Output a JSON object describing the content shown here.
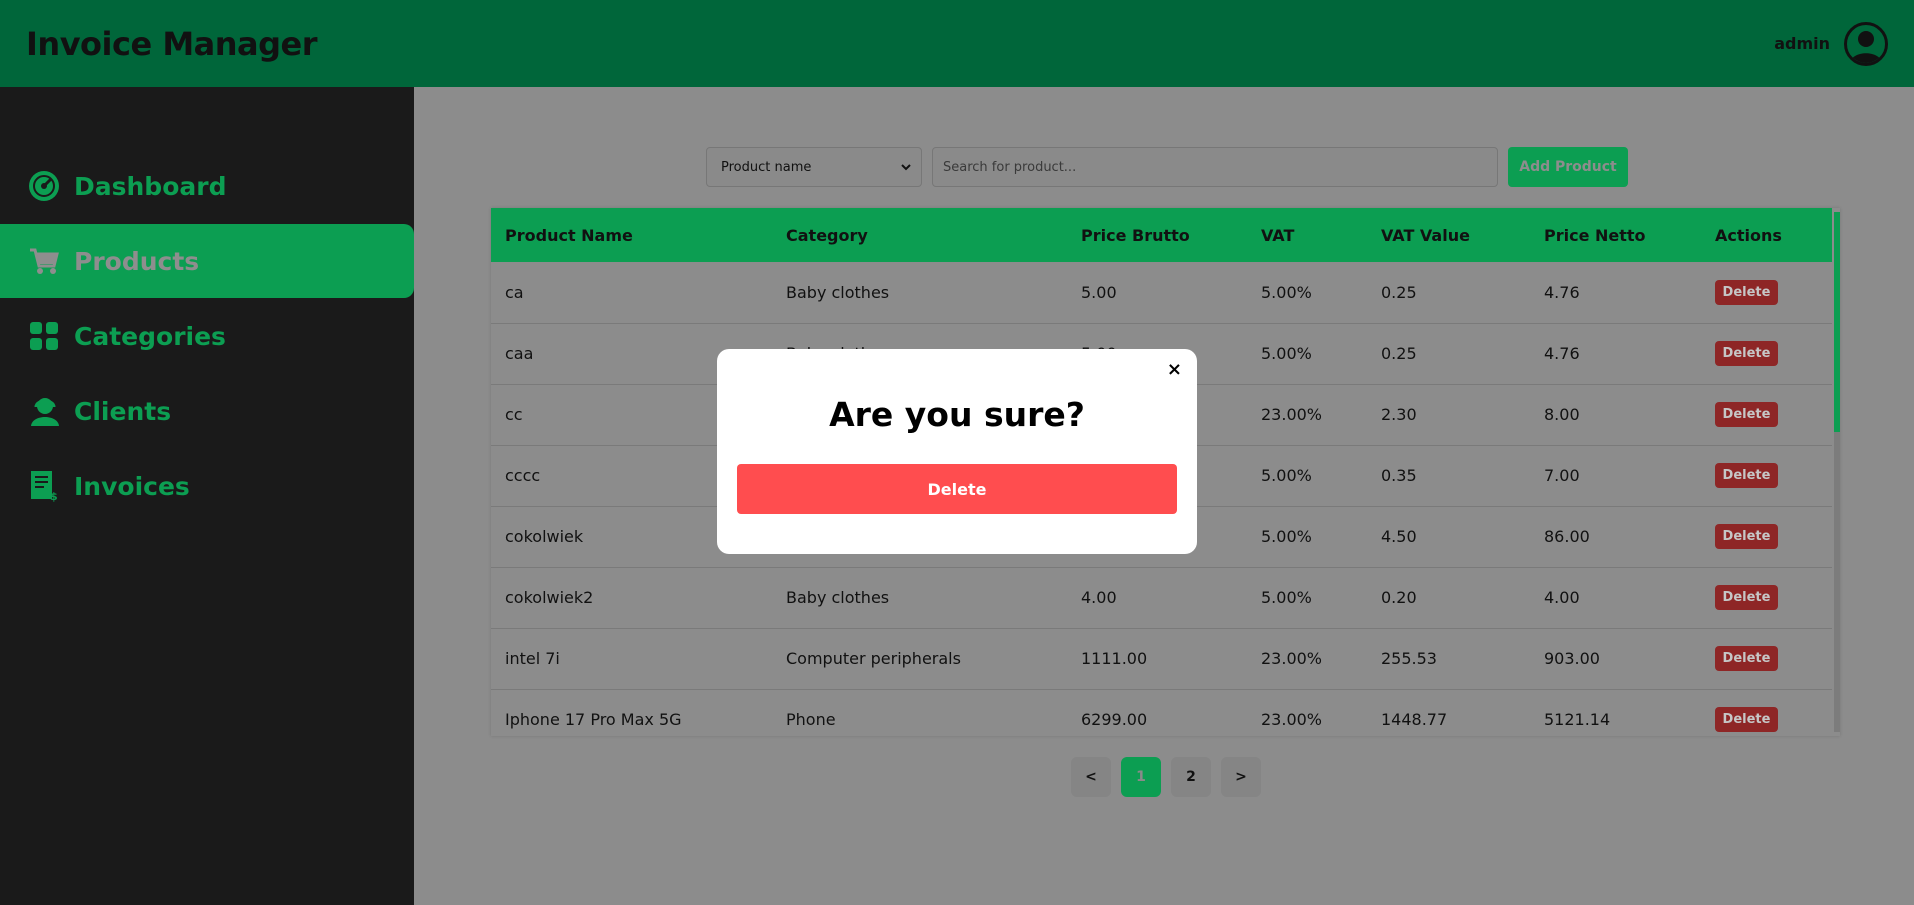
{
  "header": {
    "title": "Invoice Manager",
    "username": "admin"
  },
  "sidebar": {
    "items": [
      {
        "label": "Dashboard",
        "icon": "dashboard-gauge-icon",
        "active": false
      },
      {
        "label": "Products",
        "icon": "cart-icon",
        "active": true
      },
      {
        "label": "Categories",
        "icon": "grid-icon",
        "active": false
      },
      {
        "label": "Clients",
        "icon": "client-icon",
        "active": false
      },
      {
        "label": "Invoices",
        "icon": "invoice-icon",
        "active": false
      }
    ]
  },
  "toolbar": {
    "filter_selected": "Product name",
    "search_placeholder": "Search for product...",
    "add_label": "Add Product"
  },
  "table": {
    "columns": [
      "Product Name",
      "Category",
      "Price Brutto",
      "VAT",
      "VAT Value",
      "Price Netto",
      "Actions"
    ],
    "rows": [
      {
        "name": "ca",
        "category": "Baby clothes",
        "brutto": "5.00",
        "vat": "5.00%",
        "vat_value": "0.25",
        "netto": "4.76"
      },
      {
        "name": "caa",
        "category": "Baby clothes",
        "brutto": "5.00",
        "vat": "5.00%",
        "vat_value": "0.25",
        "netto": "4.76"
      },
      {
        "name": "cc",
        "category": "",
        "brutto": "",
        "vat": "23.00%",
        "vat_value": "2.30",
        "netto": "8.00"
      },
      {
        "name": "cccc",
        "category": "",
        "brutto": "",
        "vat": "5.00%",
        "vat_value": "0.35",
        "netto": "7.00"
      },
      {
        "name": "cokolwiek",
        "category": "",
        "brutto": "",
        "vat": "5.00%",
        "vat_value": "4.50",
        "netto": "86.00"
      },
      {
        "name": "cokolwiek2",
        "category": "Baby clothes",
        "brutto": "4.00",
        "vat": "5.00%",
        "vat_value": "0.20",
        "netto": "4.00"
      },
      {
        "name": "intel 7i",
        "category": "Computer peripherals",
        "brutto": "1111.00",
        "vat": "23.00%",
        "vat_value": "255.53",
        "netto": "903.00"
      },
      {
        "name": "Iphone 17 Pro Max 5G",
        "category": "Phone",
        "brutto": "6299.00",
        "vat": "23.00%",
        "vat_value": "1448.77",
        "netto": "5121.14"
      }
    ],
    "delete_label": "Delete"
  },
  "pagination": {
    "prev": "<",
    "pages": [
      "1",
      "2"
    ],
    "current": "1",
    "next": ">"
  },
  "modal": {
    "close": "×",
    "title": "Are you sure?",
    "delete_label": "Delete"
  },
  "colors": {
    "header": "#00663a",
    "accent": "#0c9e52",
    "sidebar": "#1a1a1a",
    "danger": "#ff4d4f"
  }
}
